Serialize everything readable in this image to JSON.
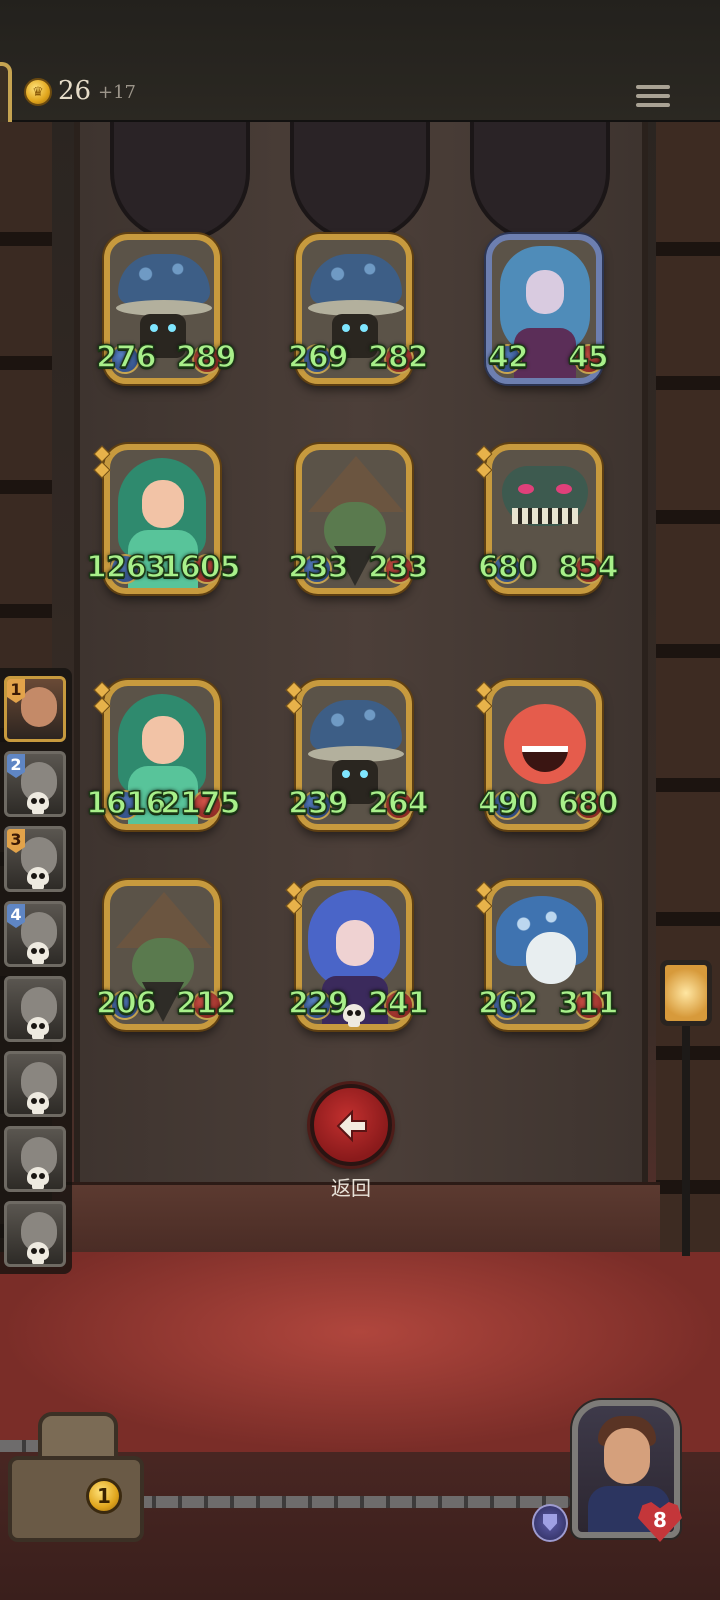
{
  "header": {
    "coins": "26",
    "coin_bonus": "+17",
    "coin_icon": "crown-coin-icon",
    "menu_icon": "hamburger-menu-icon"
  },
  "cards": [
    {
      "type": "mushroom",
      "attack": "276",
      "health": "289",
      "frame": "gold",
      "gems": 0
    },
    {
      "type": "mushroom",
      "attack": "269",
      "health": "282",
      "frame": "gold",
      "gems": 0
    },
    {
      "type": "elf",
      "attack": "42",
      "health": "45",
      "frame": "blue",
      "gems": 0
    },
    {
      "type": "fairy",
      "attack": "1263",
      "health": "1605",
      "frame": "gold",
      "gems": 2
    },
    {
      "type": "goblin",
      "attack": "233",
      "health": "233",
      "frame": "gold",
      "gems": 0
    },
    {
      "type": "bug",
      "attack": "680",
      "health": "854",
      "frame": "gold",
      "gems": 2
    },
    {
      "type": "fairy",
      "attack": "1616",
      "health": "2175",
      "frame": "gold",
      "gems": 2
    },
    {
      "type": "mushroom",
      "attack": "239",
      "health": "264",
      "frame": "gold",
      "gems": 2
    },
    {
      "type": "blob",
      "attack": "490",
      "health": "680",
      "frame": "gold",
      "gems": 2
    },
    {
      "type": "goblin",
      "attack": "206",
      "health": "212",
      "frame": "gold",
      "gems": 0
    },
    {
      "type": "witch",
      "attack": "229",
      "health": "241",
      "frame": "gold",
      "gems": 2,
      "skull": true
    },
    {
      "type": "ghost",
      "attack": "262",
      "health": "311",
      "frame": "gold",
      "gems": 2
    }
  ],
  "roster": [
    {
      "number": "1",
      "badge": "orange",
      "active": true,
      "skull": false
    },
    {
      "number": "2",
      "badge": "blue",
      "active": false,
      "skull": true
    },
    {
      "number": "3",
      "badge": "orange",
      "active": false,
      "skull": true
    },
    {
      "number": "4",
      "badge": "blue",
      "active": false,
      "skull": true
    },
    {
      "number": "",
      "badge": "",
      "active": false,
      "skull": true
    },
    {
      "number": "",
      "badge": "",
      "active": false,
      "skull": true
    },
    {
      "number": "",
      "badge": "",
      "active": false,
      "skull": true
    },
    {
      "number": "",
      "badge": "",
      "active": false,
      "skull": true
    }
  ],
  "back_button": {
    "label": "返回",
    "icon": "arrow-left-icon"
  },
  "footer": {
    "chest_count": "1",
    "hero_health": "8",
    "shield_icon": "shield-icon",
    "heart_icon": "heart-icon"
  },
  "colors": {
    "stat_text": "#a8f08a",
    "gold_frame": "#c79a3e",
    "blue_frame": "#6d7fb0",
    "back_button": "#b22a2a"
  }
}
